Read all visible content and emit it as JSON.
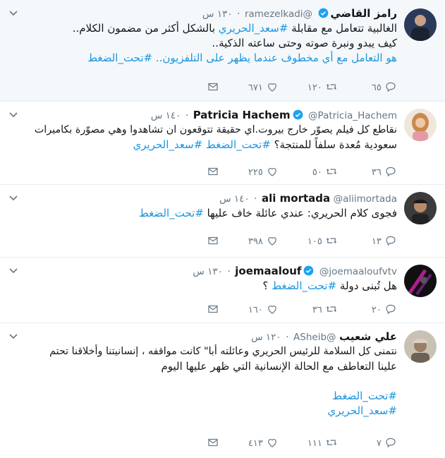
{
  "tweets": [
    {
      "name": "رامز القاضي",
      "handle": "@ramezelkadi",
      "time": "١٣٠ س",
      "verified": true,
      "lines": [
        "الغالبية تتعامل مع مقابلة #سعد_الحريري بالشكل أكثر من مضمون الكلام..",
        "كيف يبدو ونبرة صوته وحتى ساعته الذكية..",
        "هو التعامل مع أي مخطوف عندما يظهر على التلفزيون.. #تحت_الضغط"
      ],
      "replies": "٦٥",
      "retweets": "١٢٠",
      "likes": "٦٧١"
    },
    {
      "name": "Patricia Hachem",
      "handle": "@Patricia_Hachem",
      "time": "١٤٠ س",
      "verified": true,
      "lines": [
        "نقاطع كل فيلم يصوّر خارج بيروت.اي حقيقة تتوقعون ان تشاهدوا وهي مصوّرة بكاميرات",
        "سعودية مُعدة سلفاً للمنتجة؟  #تحت_الضغط #سعد_الحريري"
      ],
      "replies": "٣٦",
      "retweets": "٥٠",
      "likes": "٢٢٥"
    },
    {
      "name": "ali mortada",
      "handle": "@aliimortada",
      "time": "١٤٠ س",
      "verified": false,
      "lines": [
        "فجوى كلام الحريري: عندي عائلة خاف عليها #تحت_الضغط"
      ],
      "replies": "١٣",
      "retweets": "١٠٥",
      "likes": "٣٩٨"
    },
    {
      "name": "joemaalouf",
      "handle": "@joemaaloufvtv",
      "time": "١٣٠ س",
      "verified": true,
      "lines": [
        "هل تُبنى دولة #تحت_الضغط ؟"
      ],
      "replies": "٢٠",
      "retweets": "٣٦",
      "likes": "١٦٠"
    },
    {
      "name": "علي شعيب",
      "handle": "@ASheib",
      "time": "١٢٠ س",
      "verified": false,
      "lines": [
        "نتمنى كل السلامة للرئيس الحريري وعائلته أبا\" كانت مواقفه ، إنسانيتنا وأخلاقنا تحتم",
        "علينا التعاطف مع الحالة الإنسانية التي ظهر عليها اليوم",
        "",
        "#تحت_الضغط",
        "#سعد_الحريري"
      ],
      "replies": "٧",
      "retweets": "١١١",
      "likes": "٤١٣"
    }
  ],
  "colors": {
    "accent": "#1b95e0",
    "muted": "#657786",
    "border": "#e6ecf0"
  },
  "icons": [
    "reply-icon",
    "retweet-icon",
    "like-icon",
    "direct-message-icon",
    "verified-icon",
    "caret-down-icon"
  ]
}
